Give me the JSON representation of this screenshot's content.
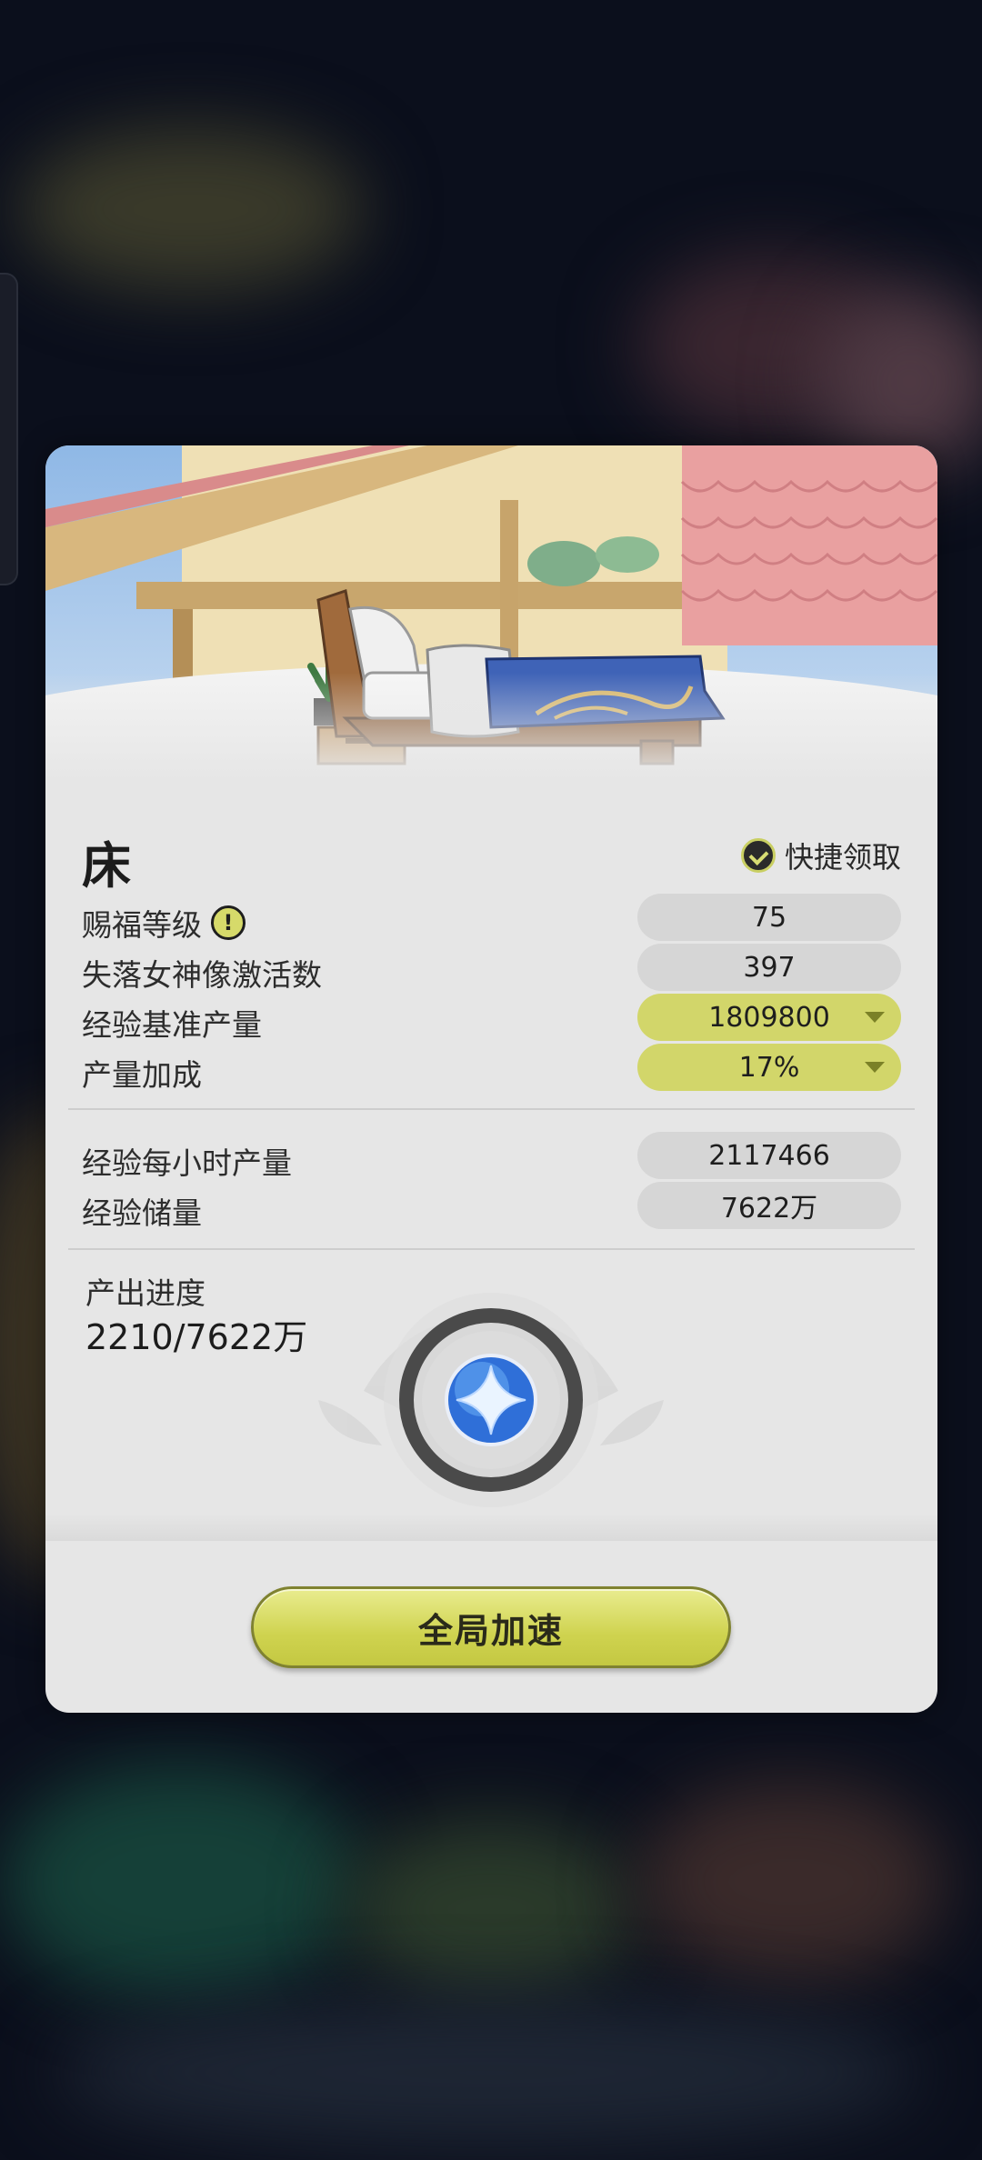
{
  "panel": {
    "title": "床",
    "quick_claim_label": "快捷领取"
  },
  "stats": [
    {
      "label": "赐福等级",
      "value": "75",
      "has_info_icon": true,
      "dropdown": false
    },
    {
      "label": "失落女神像激活数",
      "value": "397",
      "dropdown": false
    },
    {
      "label": "经验基准产量",
      "value": "1809800",
      "dropdown": true
    },
    {
      "label": "产量加成",
      "value": "17%",
      "dropdown": true
    }
  ],
  "output": [
    {
      "label": "经验每小时产量",
      "value": "2117466"
    },
    {
      "label": "经验储量",
      "value": "7622万"
    }
  ],
  "progress": {
    "label": "产出进度",
    "value": "2210/7622万"
  },
  "actions": {
    "boost_label": "全局加速"
  },
  "icons": {
    "quick_claim": "check-circle-icon",
    "info": "exclamation-icon",
    "dropdown": "triangle-down-icon",
    "orb": "star-orb-icon"
  },
  "colors": {
    "accent": "#d2d66a",
    "card_bg": "#e6e6e6",
    "pill_bg": "#d6d6d6",
    "button_accent": "#cfd34f"
  }
}
